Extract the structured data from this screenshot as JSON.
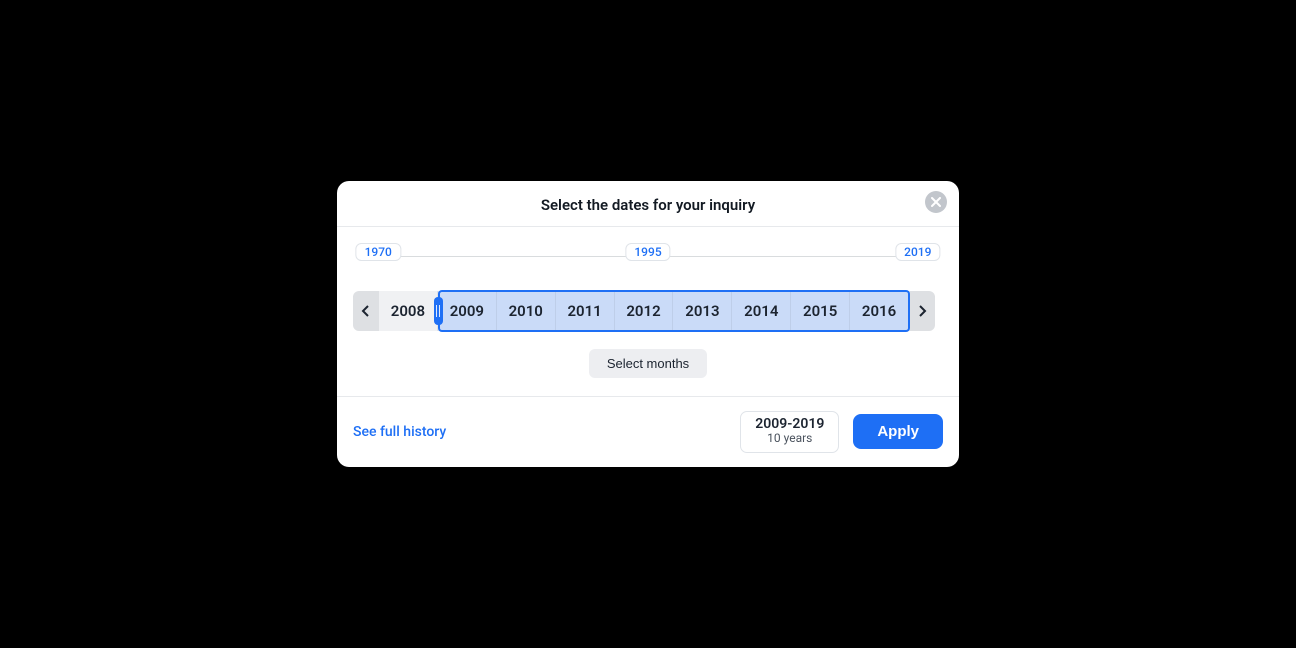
{
  "modal": {
    "title": "Select the dates for your inquiry"
  },
  "rail": {
    "ticks": [
      {
        "label": "1970",
        "pos": 3
      },
      {
        "label": "1995",
        "pos": 50
      },
      {
        "label": "2019",
        "pos": 97
      }
    ]
  },
  "years": {
    "unselected": [
      "2008"
    ],
    "selected": [
      "2009",
      "2010",
      "2011",
      "2012",
      "2013",
      "2014",
      "2015",
      "2016"
    ]
  },
  "select_months_label": "Select months",
  "footer": {
    "history_link": "See full history",
    "summary": {
      "range": "2009-2019",
      "sub": "10 years"
    },
    "apply_label": "Apply"
  },
  "icons": {
    "close": "close-icon"
  }
}
